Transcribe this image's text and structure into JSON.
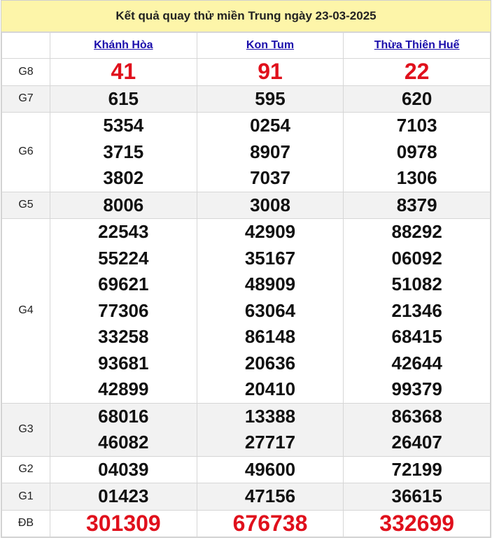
{
  "title": "Kết quả quay thử miền Trung ngày 23-03-2025",
  "provinces": [
    "Khánh Hòa",
    "Kon Tum",
    "Thừa Thiên Huế"
  ],
  "prizes": [
    {
      "label": "G8",
      "values": [
        [
          "41"
        ],
        [
          "91"
        ],
        [
          "22"
        ]
      ]
    },
    {
      "label": "G7",
      "values": [
        [
          "615"
        ],
        [
          "595"
        ],
        [
          "620"
        ]
      ]
    },
    {
      "label": "G6",
      "values": [
        [
          "5354",
          "3715",
          "3802"
        ],
        [
          "0254",
          "8907",
          "7037"
        ],
        [
          "7103",
          "0978",
          "1306"
        ]
      ]
    },
    {
      "label": "G5",
      "values": [
        [
          "8006"
        ],
        [
          "3008"
        ],
        [
          "8379"
        ]
      ]
    },
    {
      "label": "G4",
      "values": [
        [
          "22543",
          "55224",
          "69621",
          "77306",
          "33258",
          "93681",
          "42899"
        ],
        [
          "42909",
          "35167",
          "48909",
          "63064",
          "86148",
          "20636",
          "20410"
        ],
        [
          "88292",
          "06092",
          "51082",
          "21346",
          "68415",
          "42644",
          "99379"
        ]
      ]
    },
    {
      "label": "G3",
      "values": [
        [
          "68016",
          "46082"
        ],
        [
          "13388",
          "27717"
        ],
        [
          "86368",
          "26407"
        ]
      ]
    },
    {
      "label": "G2",
      "values": [
        [
          "04039"
        ],
        [
          "49600"
        ],
        [
          "72199"
        ]
      ]
    },
    {
      "label": "G1",
      "values": [
        [
          "01423"
        ],
        [
          "47156"
        ],
        [
          "36615"
        ]
      ]
    },
    {
      "label": "ĐB",
      "values": [
        [
          "301309"
        ],
        [
          "676738"
        ],
        [
          "332699"
        ]
      ]
    }
  ],
  "colors": {
    "highlight": "#e0101c",
    "title_bg": "#fdf5a9",
    "link": "#1a0dab"
  }
}
